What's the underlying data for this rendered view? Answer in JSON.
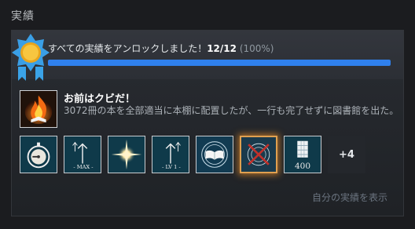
{
  "section_title": "実績",
  "summary": {
    "text": "すべての実績をアンロックしました！",
    "count": "12/12",
    "percent": "(100%)",
    "progress_value": 1.0,
    "progress_color": "#2f80ed"
  },
  "achievement": {
    "title": "お前はクビだ！",
    "description": "3072冊の本を全部適当に本棚に配置したが、一行も完了せずに図書館を出た。",
    "icon": "flame-book-icon"
  },
  "icons": [
    {
      "name": "stopwatch-icon"
    },
    {
      "name": "arrow-max-icon",
      "label": "MAX"
    },
    {
      "name": "sparkle-icon"
    },
    {
      "name": "arrow-lv1-icon",
      "label": "LV 1"
    },
    {
      "name": "open-book-circle-icon"
    },
    {
      "name": "crossed-circle-icon"
    },
    {
      "name": "bookshelf-400-icon",
      "label": "400"
    }
  ],
  "more_count": "+4",
  "view_link": "自分の実績を表示"
}
